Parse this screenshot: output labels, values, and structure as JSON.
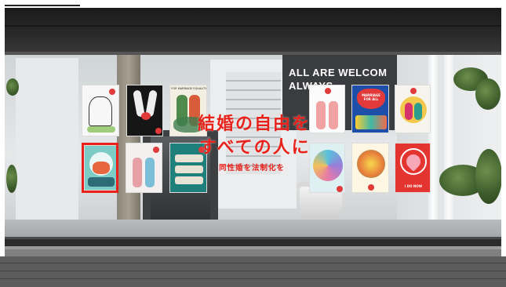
{
  "storefront": {
    "headline_line1": "結婚の自由を",
    "headline_line2": "すべての人に",
    "headline_sub": "同性婚を法制化を",
    "back_sign_line1": "ALL ARE WELCOM",
    "back_sign_line2": "ALWAYS.",
    "accent_color": "#e8221b"
  },
  "posters": [
    {
      "id": "left-1",
      "caption": ""
    },
    {
      "id": "left-2",
      "caption": ""
    },
    {
      "id": "left-3",
      "caption": "FOR MARRIAGE EQUALITY"
    },
    {
      "id": "left-4",
      "caption": ""
    },
    {
      "id": "left-5",
      "caption": ""
    },
    {
      "id": "left-6",
      "caption": ""
    },
    {
      "id": "right-1",
      "caption": ""
    },
    {
      "id": "right-2",
      "caption": "MARRIAGE FOR ALL"
    },
    {
      "id": "right-3",
      "caption": ""
    },
    {
      "id": "right-4",
      "caption": ""
    },
    {
      "id": "right-5",
      "caption": ""
    },
    {
      "id": "right-6",
      "caption": "I DO NOW"
    }
  ]
}
